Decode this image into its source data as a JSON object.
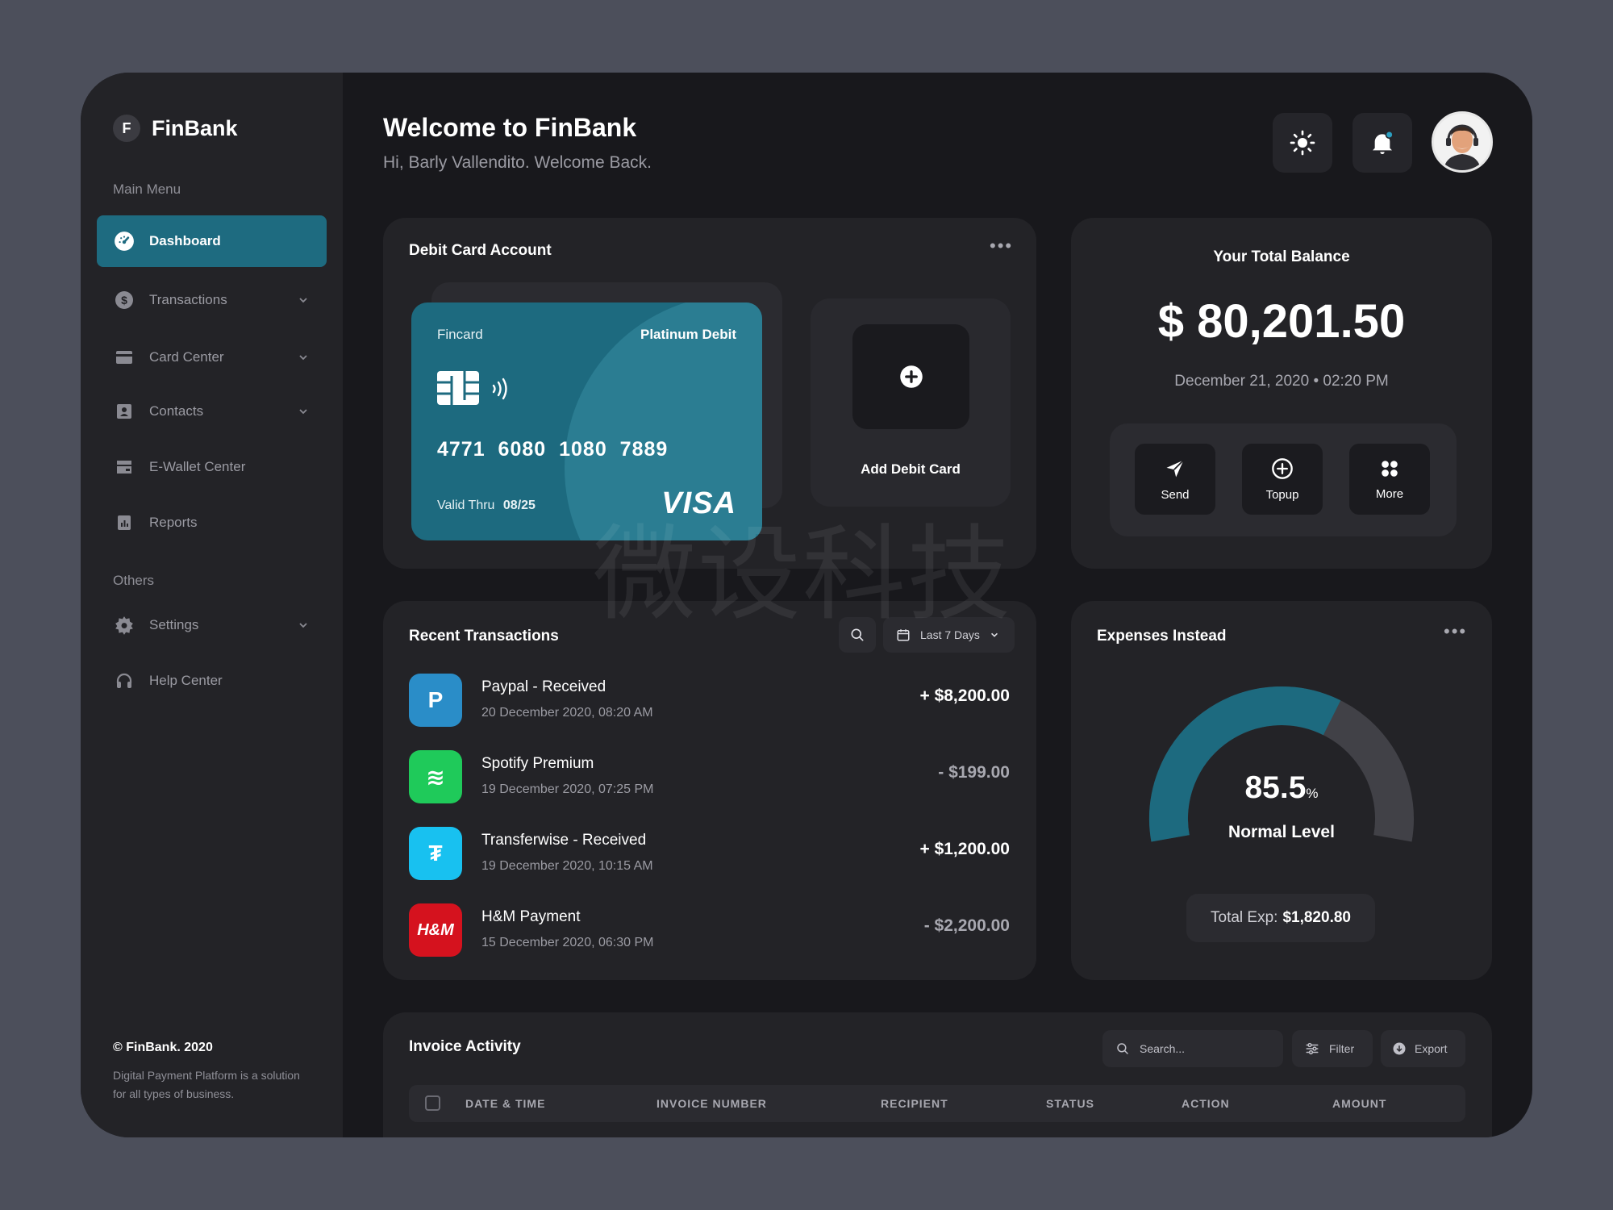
{
  "brand": {
    "logo_letter": "F",
    "name": "FinBank"
  },
  "sidebar": {
    "main_menu_label": "Main Menu",
    "items": [
      {
        "label": "Dashboard",
        "icon": "dashboard-gauge-icon",
        "active": true
      },
      {
        "label": "Transactions",
        "icon": "dollar-icon",
        "has_submenu": true
      },
      {
        "label": "Card Center",
        "icon": "card-icon",
        "has_submenu": true
      },
      {
        "label": "Contacts",
        "icon": "contacts-icon",
        "has_submenu": true
      },
      {
        "label": "E-Wallet Center",
        "icon": "wallet-icon"
      },
      {
        "label": "Reports",
        "icon": "reports-icon"
      }
    ],
    "others_label": "Others",
    "other_items": [
      {
        "label": "Settings",
        "icon": "gear-icon",
        "has_submenu": true
      },
      {
        "label": "Help Center",
        "icon": "headset-icon"
      }
    ],
    "footer_title": "© FinBank. 2020",
    "footer_text": "Digital Payment Platform is a solution for all types of business."
  },
  "header": {
    "title": "Welcome to FinBank",
    "subtitle": "Hi, Barly Vallendito. Welcome Back.",
    "buttons": [
      "sun-icon",
      "bell-icon"
    ]
  },
  "debit_card": {
    "title": "Debit Card Account",
    "card_brand": "Fincard",
    "card_type": "Platinum Debit",
    "card_number": "4771 6080 1080 7889",
    "valid_label": "Valid Thru",
    "valid_value": "08/25",
    "network": "VISA",
    "add_label": "Add Debit Card",
    "accent": "#1d6a7f"
  },
  "balance": {
    "title": "Your Total Balance",
    "amount": "$ 80,201.50",
    "date": "December 21, 2020  •  02:20 PM",
    "actions": [
      {
        "label": "Send",
        "icon": "send-icon"
      },
      {
        "label": "Topup",
        "icon": "plus-circle-icon"
      },
      {
        "label": "More",
        "icon": "grid-icon"
      }
    ]
  },
  "transactions": {
    "title": "Recent Transactions",
    "filter_label": "Last 7 Days",
    "rows": [
      {
        "name": "Paypal - Received",
        "date": "20 December 2020, 08:20 AM",
        "amount": "+ $8,200.00",
        "logo": "paypal-icon",
        "logo_text": "P",
        "color": "#2a8dc8"
      },
      {
        "name": "Spotify Premium",
        "date": "19 December 2020, 07:25 PM",
        "amount": "- $199.00",
        "logo": "spotify-icon",
        "logo_text": "≋",
        "color": "#1fca5a"
      },
      {
        "name": "Transferwise - Received",
        "date": "19 December 2020, 10:15 AM",
        "amount": "+ $1,200.00",
        "logo": "transferwise-icon",
        "logo_text": "₮",
        "color": "#18c1f0"
      },
      {
        "name": "H&M Payment",
        "date": "15 December 2020, 06:30 PM",
        "amount": "- $2,200.00",
        "logo": "hm-icon",
        "logo_text": "H&M",
        "color": "#d5121e"
      }
    ]
  },
  "expenses": {
    "title": "Expenses Instead",
    "percent": "85.5",
    "percent_unit": "%",
    "percent_value": 85.5,
    "level": "Normal Level",
    "total_label": "Total Exp:",
    "total_value": "$1,820.80",
    "colors": {
      "fill": "#1d6a7f",
      "rest": "#414147"
    }
  },
  "invoice": {
    "title": "Invoice Activity",
    "search_placeholder": "Search...",
    "filter_label": "Filter",
    "export_label": "Export",
    "columns": [
      "DATE & TIME",
      "INVOICE NUMBER",
      "RECIPIENT",
      "STATUS",
      "ACTION",
      "AMOUNT"
    ]
  },
  "watermark": "微设科技"
}
